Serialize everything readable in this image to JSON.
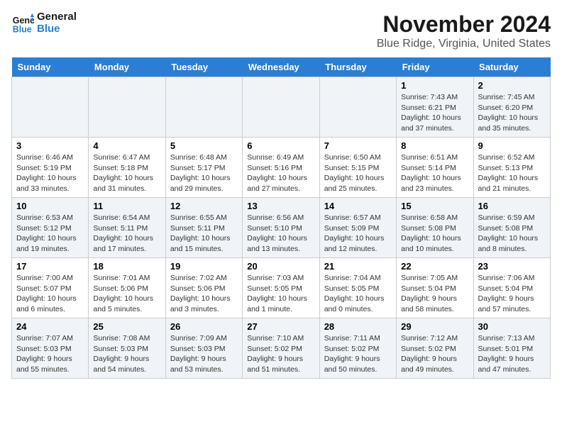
{
  "logo": {
    "line1": "General",
    "line2": "Blue",
    "icon_color": "#2b7ed4"
  },
  "title": "November 2024",
  "location": "Blue Ridge, Virginia, United States",
  "days_of_week": [
    "Sunday",
    "Monday",
    "Tuesday",
    "Wednesday",
    "Thursday",
    "Friday",
    "Saturday"
  ],
  "weeks": [
    {
      "cells": [
        {
          "date": "",
          "info": "",
          "empty": true
        },
        {
          "date": "",
          "info": "",
          "empty": true
        },
        {
          "date": "",
          "info": "",
          "empty": true
        },
        {
          "date": "",
          "info": "",
          "empty": true
        },
        {
          "date": "",
          "info": "",
          "empty": true
        },
        {
          "date": "1",
          "info": "Sunrise: 7:43 AM\nSunset: 6:21 PM\nDaylight: 10 hours and 37 minutes.",
          "empty": false
        },
        {
          "date": "2",
          "info": "Sunrise: 7:45 AM\nSunset: 6:20 PM\nDaylight: 10 hours and 35 minutes.",
          "empty": false
        }
      ]
    },
    {
      "cells": [
        {
          "date": "3",
          "info": "Sunrise: 6:46 AM\nSunset: 5:19 PM\nDaylight: 10 hours and 33 minutes.",
          "empty": false
        },
        {
          "date": "4",
          "info": "Sunrise: 6:47 AM\nSunset: 5:18 PM\nDaylight: 10 hours and 31 minutes.",
          "empty": false
        },
        {
          "date": "5",
          "info": "Sunrise: 6:48 AM\nSunset: 5:17 PM\nDaylight: 10 hours and 29 minutes.",
          "empty": false
        },
        {
          "date": "6",
          "info": "Sunrise: 6:49 AM\nSunset: 5:16 PM\nDaylight: 10 hours and 27 minutes.",
          "empty": false
        },
        {
          "date": "7",
          "info": "Sunrise: 6:50 AM\nSunset: 5:15 PM\nDaylight: 10 hours and 25 minutes.",
          "empty": false
        },
        {
          "date": "8",
          "info": "Sunrise: 6:51 AM\nSunset: 5:14 PM\nDaylight: 10 hours and 23 minutes.",
          "empty": false
        },
        {
          "date": "9",
          "info": "Sunrise: 6:52 AM\nSunset: 5:13 PM\nDaylight: 10 hours and 21 minutes.",
          "empty": false
        }
      ]
    },
    {
      "cells": [
        {
          "date": "10",
          "info": "Sunrise: 6:53 AM\nSunset: 5:12 PM\nDaylight: 10 hours and 19 minutes.",
          "empty": false
        },
        {
          "date": "11",
          "info": "Sunrise: 6:54 AM\nSunset: 5:11 PM\nDaylight: 10 hours and 17 minutes.",
          "empty": false
        },
        {
          "date": "12",
          "info": "Sunrise: 6:55 AM\nSunset: 5:11 PM\nDaylight: 10 hours and 15 minutes.",
          "empty": false
        },
        {
          "date": "13",
          "info": "Sunrise: 6:56 AM\nSunset: 5:10 PM\nDaylight: 10 hours and 13 minutes.",
          "empty": false
        },
        {
          "date": "14",
          "info": "Sunrise: 6:57 AM\nSunset: 5:09 PM\nDaylight: 10 hours and 12 minutes.",
          "empty": false
        },
        {
          "date": "15",
          "info": "Sunrise: 6:58 AM\nSunset: 5:08 PM\nDaylight: 10 hours and 10 minutes.",
          "empty": false
        },
        {
          "date": "16",
          "info": "Sunrise: 6:59 AM\nSunset: 5:08 PM\nDaylight: 10 hours and 8 minutes.",
          "empty": false
        }
      ]
    },
    {
      "cells": [
        {
          "date": "17",
          "info": "Sunrise: 7:00 AM\nSunset: 5:07 PM\nDaylight: 10 hours and 6 minutes.",
          "empty": false
        },
        {
          "date": "18",
          "info": "Sunrise: 7:01 AM\nSunset: 5:06 PM\nDaylight: 10 hours and 5 minutes.",
          "empty": false
        },
        {
          "date": "19",
          "info": "Sunrise: 7:02 AM\nSunset: 5:06 PM\nDaylight: 10 hours and 3 minutes.",
          "empty": false
        },
        {
          "date": "20",
          "info": "Sunrise: 7:03 AM\nSunset: 5:05 PM\nDaylight: 10 hours and 1 minute.",
          "empty": false
        },
        {
          "date": "21",
          "info": "Sunrise: 7:04 AM\nSunset: 5:05 PM\nDaylight: 10 hours and 0 minutes.",
          "empty": false
        },
        {
          "date": "22",
          "info": "Sunrise: 7:05 AM\nSunset: 5:04 PM\nDaylight: 9 hours and 58 minutes.",
          "empty": false
        },
        {
          "date": "23",
          "info": "Sunrise: 7:06 AM\nSunset: 5:04 PM\nDaylight: 9 hours and 57 minutes.",
          "empty": false
        }
      ]
    },
    {
      "cells": [
        {
          "date": "24",
          "info": "Sunrise: 7:07 AM\nSunset: 5:03 PM\nDaylight: 9 hours and 55 minutes.",
          "empty": false
        },
        {
          "date": "25",
          "info": "Sunrise: 7:08 AM\nSunset: 5:03 PM\nDaylight: 9 hours and 54 minutes.",
          "empty": false
        },
        {
          "date": "26",
          "info": "Sunrise: 7:09 AM\nSunset: 5:03 PM\nDaylight: 9 hours and 53 minutes.",
          "empty": false
        },
        {
          "date": "27",
          "info": "Sunrise: 7:10 AM\nSunset: 5:02 PM\nDaylight: 9 hours and 51 minutes.",
          "empty": false
        },
        {
          "date": "28",
          "info": "Sunrise: 7:11 AM\nSunset: 5:02 PM\nDaylight: 9 hours and 50 minutes.",
          "empty": false
        },
        {
          "date": "29",
          "info": "Sunrise: 7:12 AM\nSunset: 5:02 PM\nDaylight: 9 hours and 49 minutes.",
          "empty": false
        },
        {
          "date": "30",
          "info": "Sunrise: 7:13 AM\nSunset: 5:01 PM\nDaylight: 9 hours and 47 minutes.",
          "empty": false
        }
      ]
    }
  ]
}
